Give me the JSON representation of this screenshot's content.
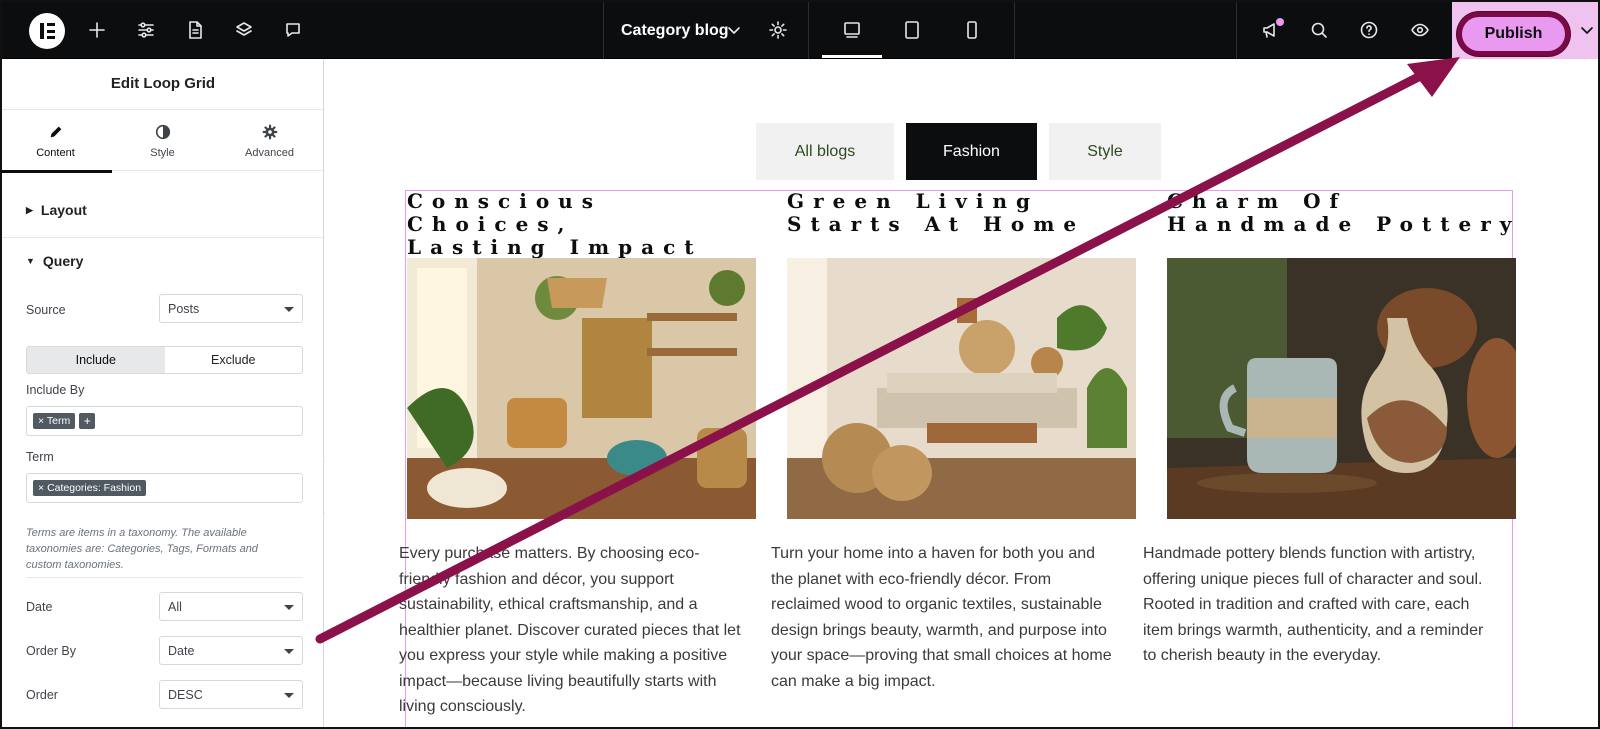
{
  "topbar": {
    "document_title": "Category blog",
    "publish_label": "Publish",
    "icons": [
      "elementor-logo-icon",
      "plus-icon",
      "sliders-icon",
      "page-icon",
      "layers-icon",
      "comment-icon",
      "chevron-down-icon",
      "settings-gear-icon",
      "desktop-icon",
      "tablet-icon",
      "mobile-icon",
      "announcement-icon",
      "search-icon",
      "help-icon",
      "preview-eye-icon",
      "publish-options-chevron-icon"
    ],
    "accent_color": "#e99af0",
    "highlight_ring_color": "#7a0a46"
  },
  "panel": {
    "title": "Edit Loop Grid",
    "tabs": [
      {
        "label": "Content",
        "icon": "pencil-icon",
        "active": true
      },
      {
        "label": "Style",
        "icon": "half-circle-icon",
        "active": false
      },
      {
        "label": "Advanced",
        "icon": "gear-icon",
        "active": false
      }
    ],
    "sections": {
      "layout": "Layout",
      "query": "Query"
    },
    "fields": {
      "source": {
        "label": "Source",
        "value": "Posts"
      },
      "include_toggle": {
        "include": "Include",
        "exclude": "Exclude",
        "selected": "Include"
      },
      "include_by": {
        "label": "Include By",
        "tag": "Term",
        "add": "+"
      },
      "term": {
        "label": "Term",
        "tag": "Categories: Fashion"
      },
      "help_text": "Terms are items in a taxonomy. The available taxonomies are: Categories, Tags, Formats and custom taxonomies.",
      "date": {
        "label": "Date",
        "value": "All"
      },
      "order_by": {
        "label": "Order By",
        "value": "Date"
      },
      "order": {
        "label": "Order",
        "value": "DESC"
      }
    },
    "collapse_icon": "chevron-left-icon"
  },
  "canvas": {
    "filters": [
      {
        "label": "All blogs",
        "active": false
      },
      {
        "label": "Fashion",
        "active": true
      },
      {
        "label": "Style",
        "active": false
      }
    ],
    "posts": [
      {
        "title": "Conscious Choices,\nLasting Impact",
        "excerpt": "Every purchase matters. By choosing eco-friendly fashion and décor, you support sustainability, ethical craftsmanship, and a healthier planet. Discover curated pieces that let you express your style while making a positive impact—because living beautifully starts with living consciously."
      },
      {
        "title": "Green Living\nStarts At Home",
        "excerpt": "Turn your home into a haven for both you and the planet with eco-friendly décor. From reclaimed wood to organic textiles, sustainable design brings beauty, warmth, and purpose into your space—proving that small choices at home can make a big impact."
      },
      {
        "title": "Charm Of\nHandmade Pottery",
        "excerpt": "Handmade pottery blends function with artistry, offering unique pieces full of character and soul. Rooted in tradition and crafted with care, each item brings warmth, authenticity, and a reminder to cherish beauty in the everyday."
      }
    ]
  }
}
